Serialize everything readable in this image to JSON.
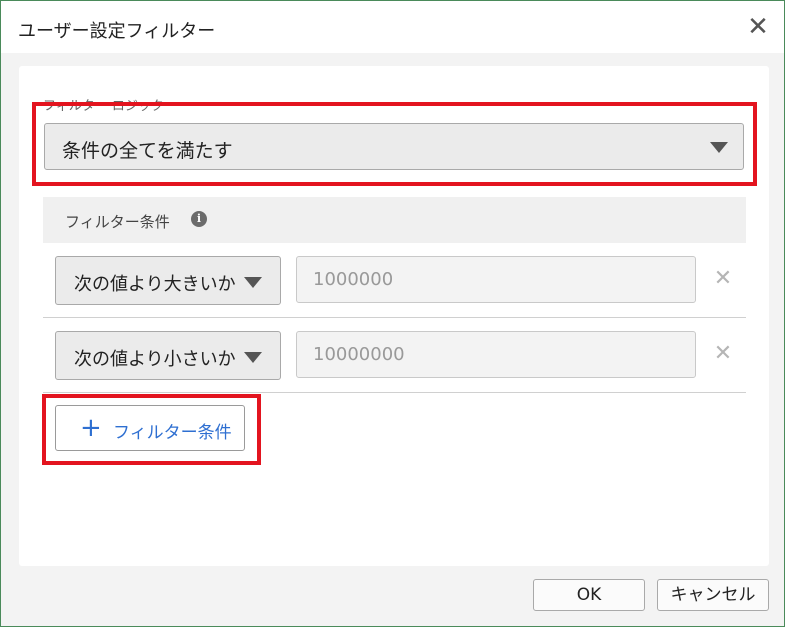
{
  "dialog": {
    "title": "ユーザー設定フィルター",
    "close_icon": "close-icon"
  },
  "logic": {
    "label": "フィルター ロジック",
    "selected": "条件の全てを満たす"
  },
  "conditions": {
    "header": "フィルター条件",
    "info_icon": "info-icon",
    "rows": [
      {
        "operator": "次の値より大きいか",
        "value": "1000000"
      },
      {
        "operator": "次の値より小さいか",
        "value": "10000000"
      }
    ]
  },
  "add_button": {
    "label": "フィルター条件"
  },
  "footer": {
    "ok_label": "OK",
    "cancel_label": "キャンセル"
  },
  "colors": {
    "highlight": "#e3141f",
    "accent": "#2e6fd1",
    "border": "#4a8a5a"
  }
}
